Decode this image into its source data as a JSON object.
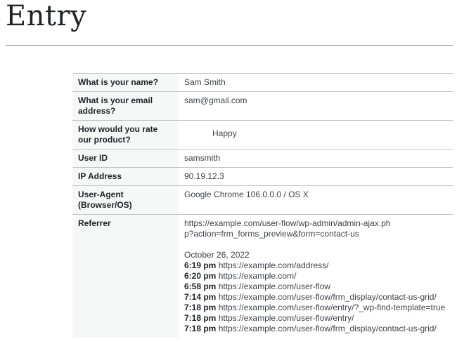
{
  "page": {
    "title": "Entry"
  },
  "fields": [
    {
      "label": "What is your name?",
      "value": "Sam Smith"
    },
    {
      "label": "What is your email address?",
      "value": "sam@gmail.com"
    },
    {
      "label": "How would you rate our product?",
      "value": "Happy"
    },
    {
      "label": "User ID",
      "value": "samsmith"
    },
    {
      "label": "IP Address",
      "value": "90.19.12.3"
    },
    {
      "label": "User-Agent (Browser/OS)",
      "value": "Google Chrome 106.0.0.0 / OS X"
    }
  ],
  "referrer": {
    "label": "Referrer",
    "url": "https://example.com/user-flow/wp-admin/admin-ajax.php?action=frm_forms_preview&form=contact-us",
    "date": "October 26, 2022",
    "history": [
      {
        "time": "6:19 pm",
        "url": "https://example.com/address/"
      },
      {
        "time": "6:20 pm",
        "url": "https://example.com/"
      },
      {
        "time": "6:58 pm",
        "url": "https://example.com/user-flow"
      },
      {
        "time": "7:14 pm",
        "url": "https://example.com/user-flow/frm_display/contact-us-grid/"
      },
      {
        "time": "7:18 pm",
        "url": "https://example.com/user-flow/entry/?_wp-find-template=true"
      },
      {
        "time": "7:18 pm",
        "url": "https://example.com/user-flow/entry/"
      },
      {
        "time": "7:18 pm",
        "url": "https://example.com/user-flow/frm_display/contact-us-grid/"
      }
    ]
  }
}
